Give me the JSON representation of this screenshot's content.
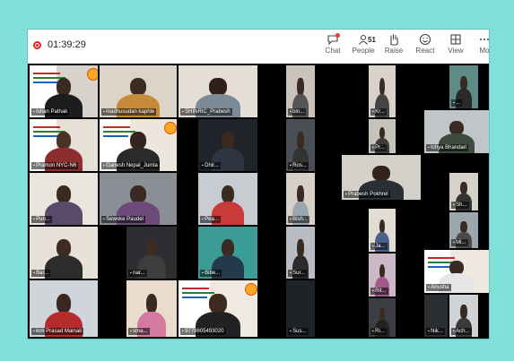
{
  "meeting": {
    "timer": "01:39:29",
    "people_count": "51"
  },
  "toolbar": {
    "chat": "Chat",
    "people": "People",
    "raise": "Raise",
    "react": "React",
    "view": "View",
    "more": "Mo"
  },
  "participants": [
    "Ishan Pathak",
    "madhusudan kaphle",
    "SHINRIC_Prabesh",
    "bin...",
    "Kr...",
    "...",
    "Pramon NYC-N6",
    "Ganesh Nepal_Jumla",
    "Dhir...",
    "Ros...",
    "Pr...",
    "Ichya Bhandari",
    "Prabesh Pokhrel",
    "Sh...",
    "Pun...",
    "Sewoke Paudel",
    "Pea...",
    "Bish...",
    "Ja...",
    "Mi...",
    "Bar...",
    "nar...",
    "Bibe...",
    "Sur...",
    "Rit...",
    "Anusha",
    "Ach...",
    "kim Prasad Mainali",
    "sma...",
    "9779805493020",
    "Sus...",
    "Ri...",
    "Nik..."
  ]
}
